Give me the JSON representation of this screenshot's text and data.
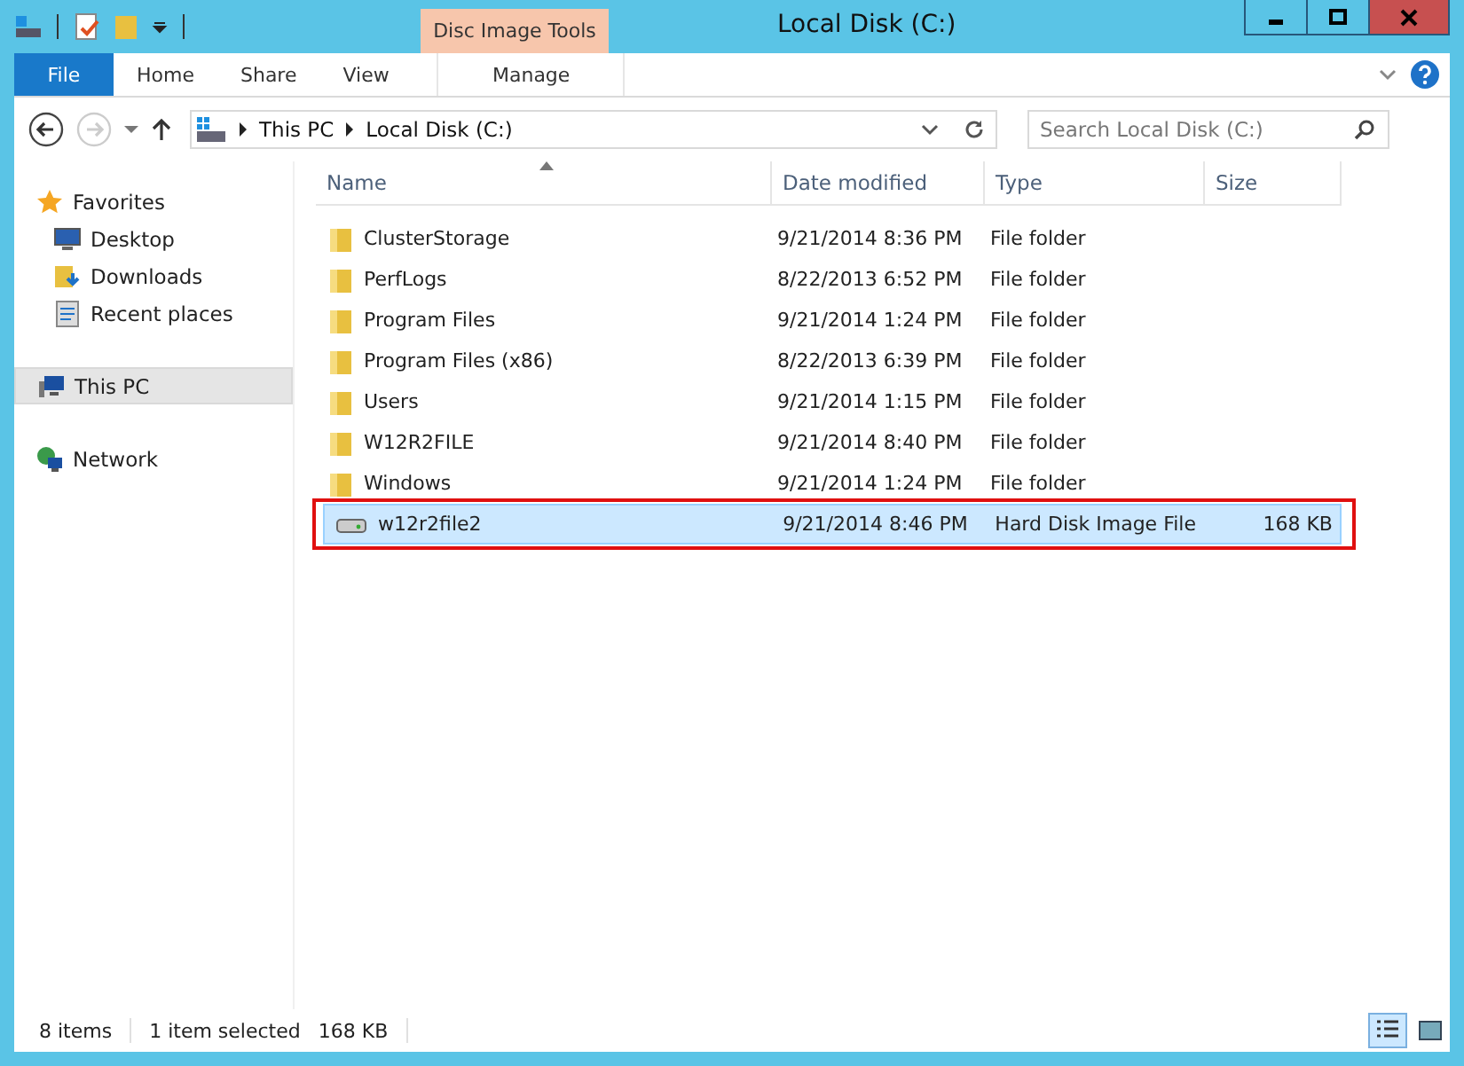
{
  "window": {
    "title": "Local Disk (C:)"
  },
  "contextual_tab_group": {
    "label": "Disc Image Tools"
  },
  "ribbon_tabs": [
    {
      "label": "File",
      "kind": "file",
      "selected": false
    },
    {
      "label": "Home",
      "kind": "tab",
      "selected": false
    },
    {
      "label": "Share",
      "kind": "tab",
      "selected": false
    },
    {
      "label": "View",
      "kind": "tab",
      "selected": false
    },
    {
      "label": "Manage",
      "kind": "context",
      "selected": false
    }
  ],
  "address_bar": {
    "path": [
      "This PC",
      "Local Disk (C:)"
    ]
  },
  "search": {
    "placeholder": "Search Local Disk (C:)"
  },
  "sidebar": {
    "groups": [
      {
        "label": "Favorites",
        "kind": "star",
        "selected": false,
        "children": [
          {
            "label": "Desktop",
            "kind": "desktop",
            "selected": false
          },
          {
            "label": "Downloads",
            "kind": "downloads",
            "selected": false
          },
          {
            "label": "Recent places",
            "kind": "recent",
            "selected": false
          }
        ]
      },
      {
        "label": "This PC",
        "kind": "pc",
        "selected": true
      },
      {
        "label": "Network",
        "kind": "network",
        "selected": false
      }
    ]
  },
  "table": {
    "columns": [
      "Name",
      "Date modified",
      "Type",
      "Size"
    ],
    "rows": [
      {
        "kind": "folder",
        "name": "ClusterStorage",
        "date": "9/21/2014 8:36 PM",
        "type": "File folder",
        "selected": false,
        "outlined": false
      },
      {
        "kind": "folder",
        "name": "PerfLogs",
        "date": "8/22/2013 6:52 PM",
        "type": "File folder",
        "selected": false,
        "outlined": false
      },
      {
        "kind": "folder",
        "name": "Program Files",
        "date": "9/21/2014 1:24 PM",
        "type": "File folder",
        "selected": false,
        "outlined": false
      },
      {
        "kind": "folder",
        "name": "Program Files (x86)",
        "date": "8/22/2013 6:39 PM",
        "type": "File folder",
        "selected": false,
        "outlined": false
      },
      {
        "kind": "folder",
        "name": "Users",
        "date": "9/21/2014 1:15 PM",
        "type": "File folder",
        "selected": false,
        "outlined": false
      },
      {
        "kind": "folder",
        "name": "W12R2FILE",
        "date": "9/21/2014 8:40 PM",
        "type": "File folder",
        "selected": false,
        "outlined": false
      },
      {
        "kind": "folder",
        "name": "Windows",
        "date": "9/21/2014 1:24 PM",
        "type": "File folder",
        "selected": false,
        "outlined": false
      },
      {
        "kind": "disk",
        "name": "w12r2file2",
        "date": "9/21/2014 8:46 PM",
        "type": "Hard Disk Image File",
        "size": "168 KB",
        "selected": true,
        "outlined": true
      }
    ]
  },
  "status_bar": {
    "item_count": "8 items",
    "selection": "1 item selected",
    "selection_size": "168 KB"
  },
  "view_buttons": [
    {
      "kind": "details",
      "selected": true
    },
    {
      "kind": "tiles",
      "selected": false
    }
  ]
}
